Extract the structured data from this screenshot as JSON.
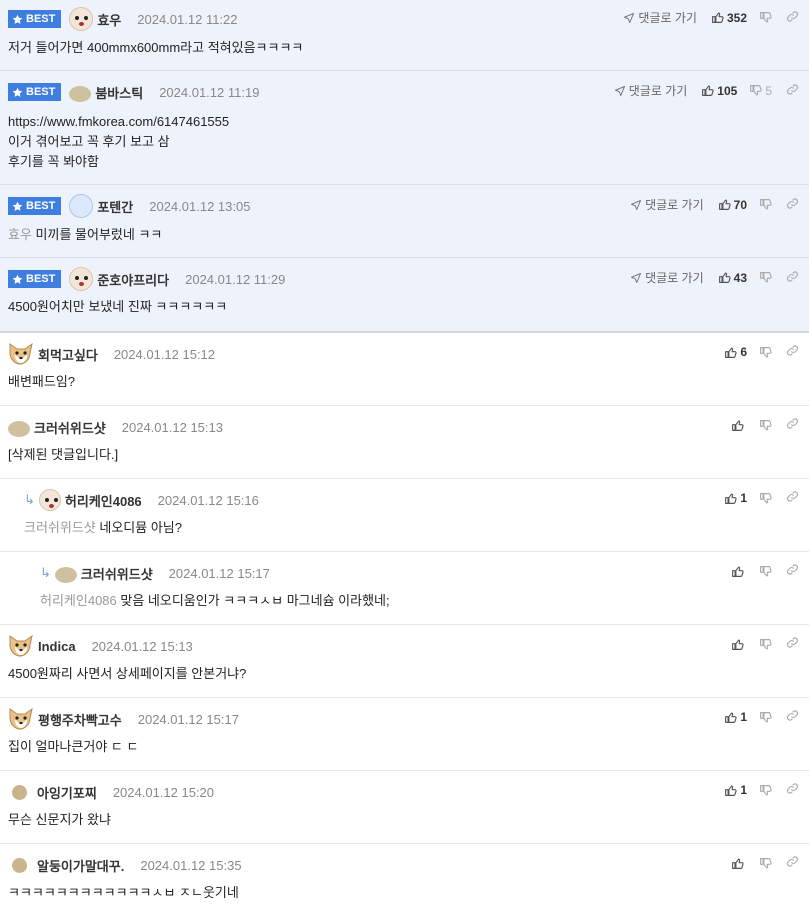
{
  "best_label": "BEST",
  "goto_label": "댓글로 가기",
  "best": [
    {
      "nick": "효우",
      "date": "2024.01.12 11:22",
      "up": "352",
      "down": "",
      "lines": [
        "저거 들어가면 400mmx600mm라고 적혀있음ㅋㅋㅋㅋ"
      ]
    },
    {
      "nick": "붐바스틱",
      "date": "2024.01.12 11:19",
      "up": "105",
      "down": "5",
      "lines": [
        "https://www.fmkorea.com/6147461555",
        "이거 겪어보고 꼭 후기 보고 삼",
        "후기를 꼭 봐야함"
      ]
    },
    {
      "nick": "포텐간",
      "date": "2024.01.12 13:05",
      "up": "70",
      "down": "",
      "reply_to": "효우",
      "lines": [
        "미끼를 물어부렀네 ㅋㅋ"
      ]
    },
    {
      "nick": "준호야프리다",
      "date": "2024.01.12 11:29",
      "up": "43",
      "down": "",
      "lines": [
        "4500원어치만 보냈네 진짜 ㅋㅋㅋㅋㅋㅋ"
      ]
    }
  ],
  "comments": [
    {
      "nick": "회먹고싶다",
      "date": "2024.01.12 15:12",
      "up": "6",
      "text": "배변패드임?"
    },
    {
      "nick": "크러쉬위드샷",
      "date": "2024.01.12 15:13",
      "up": "",
      "text": "[삭제된 댓글입니다.]"
    },
    {
      "nick": "허리케인4086",
      "date": "2024.01.12 15:16",
      "up": "1",
      "reply_to": "크러쉬위드샷",
      "text": "네오디뮴 아님?"
    },
    {
      "nick": "크러쉬위드샷",
      "date": "2024.01.12 15:17",
      "up": "",
      "reply_to": "허리케인4086",
      "text": "맞음 네오디움인가 ㅋㅋㅋㅅㅂ 마그네슘 이라했네;"
    },
    {
      "nick": "Indica",
      "date": "2024.01.12 15:13",
      "up": "",
      "text": "4500원짜리 사면서 상세페이지를 안본거냐?"
    },
    {
      "nick": "평행주차빡고수",
      "date": "2024.01.12 15:17",
      "up": "1",
      "text": "집이 얼마나큰거야 ㄷ ㄷ"
    },
    {
      "nick": "아잉기포찌",
      "date": "2024.01.12 15:20",
      "up": "1",
      "text": "무슨 신문지가 왔냐"
    },
    {
      "nick": "알둥이가말대꾸.",
      "date": "2024.01.12 15:35",
      "up": "",
      "text": "ㅋㅋㅋㅋㅋㅋㅋㅋㅋㅋㅋㅋㅅㅂ ㅈㄴ웃기네"
    }
  ]
}
